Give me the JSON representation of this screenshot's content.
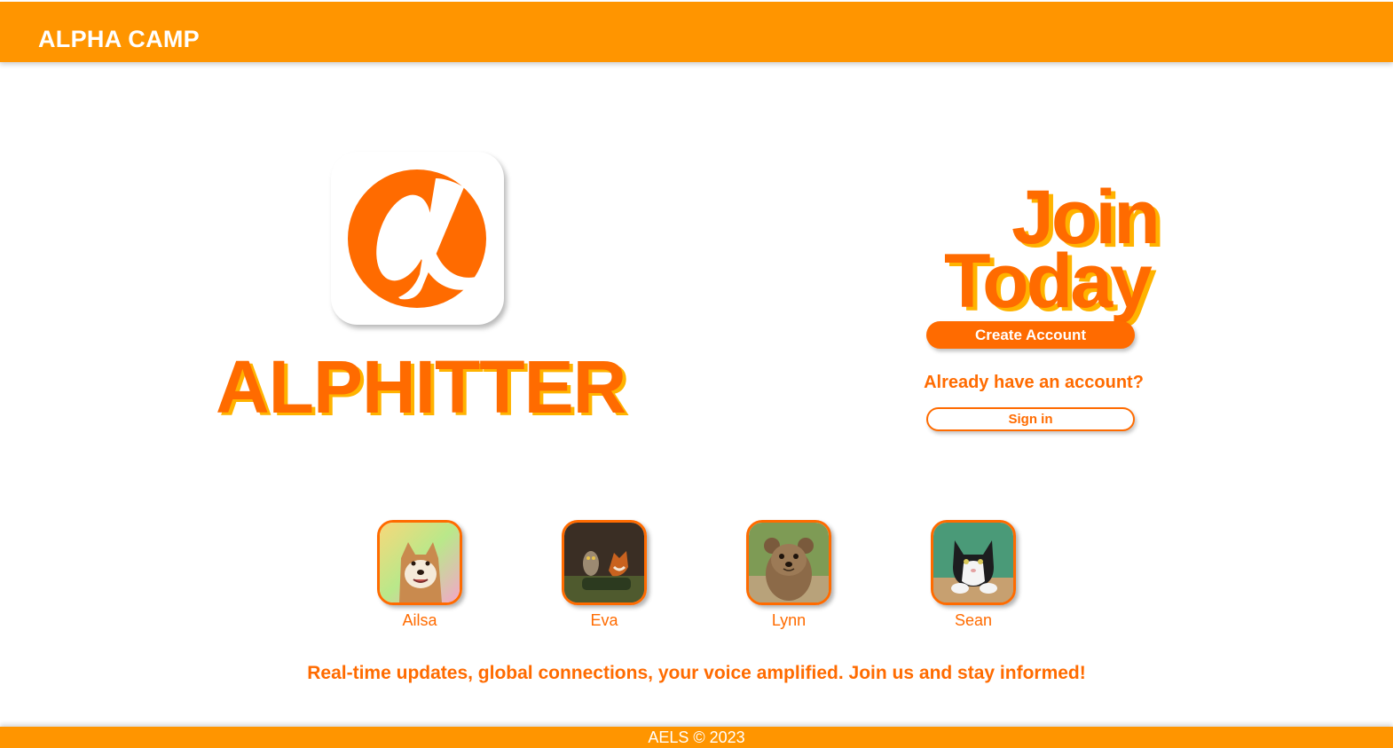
{
  "header": {
    "brand": "ALPHA CAMP"
  },
  "logo": {
    "icon": "alpha-logo-icon",
    "app_name": "ALPHITTER"
  },
  "join": {
    "line1": "Join",
    "line2": "Today",
    "create_account_label": "Create Account",
    "already_text": "Already have an account?",
    "sign_in_label": "Sign in"
  },
  "members": [
    {
      "name": "Ailsa",
      "avatar": "shiba-dog-avatar"
    },
    {
      "name": "Eva",
      "avatar": "owl-and-fox-avatar"
    },
    {
      "name": "Lynn",
      "avatar": "quokka-avatar"
    },
    {
      "name": "Sean",
      "avatar": "cat-avatar"
    }
  ],
  "tagline": "Real-time updates, global connections, your voice amplified. Join us and stay informed!",
  "footer": {
    "copyright": "AELS © 2023"
  },
  "colors": {
    "header_bg": "#ff9500",
    "accent": "#ff6b00",
    "shadow_text": "#ffb300"
  }
}
